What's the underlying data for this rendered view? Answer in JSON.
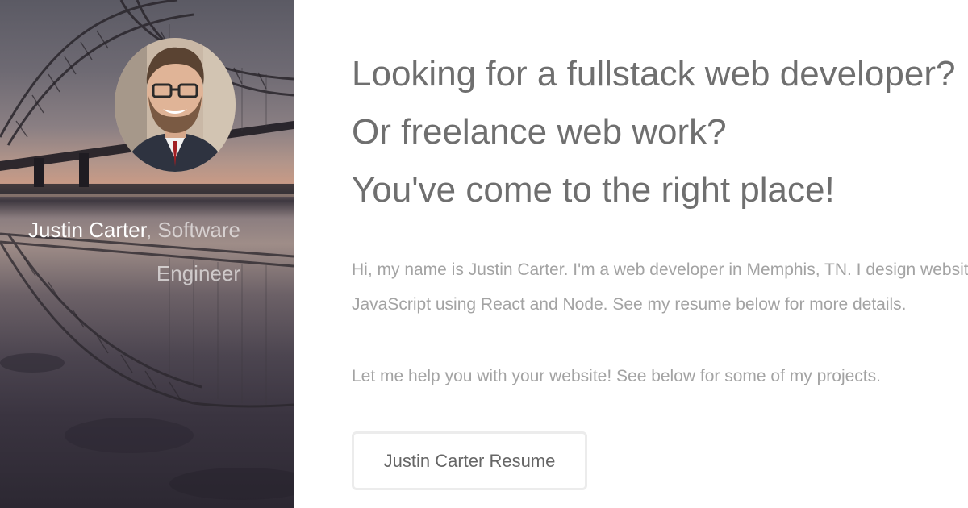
{
  "sidebar": {
    "name": "Justin Carter",
    "separator": ",",
    "role": " Software Engineer",
    "avatar_icon": "profile-photo",
    "background_image": "bridge-reflection-photo"
  },
  "main": {
    "headline": [
      "Looking for a fullstack web developer?",
      "Or freelance web work?",
      "You've come to the right place!"
    ],
    "intro": [
      "Hi, my name is Justin Carter. I'm a web developer in Memphis, TN. I design websites and",
      "JavaScript using React and Node. See my resume below for more details."
    ],
    "help": "Let me help you with your website! See below for some of my projects.",
    "resume_button_label": "Justin Carter Resume"
  },
  "colors": {
    "headline": "#6f6f6f",
    "body_text": "#a3a3a3",
    "button_border": "#ececec",
    "button_text": "#666666"
  }
}
